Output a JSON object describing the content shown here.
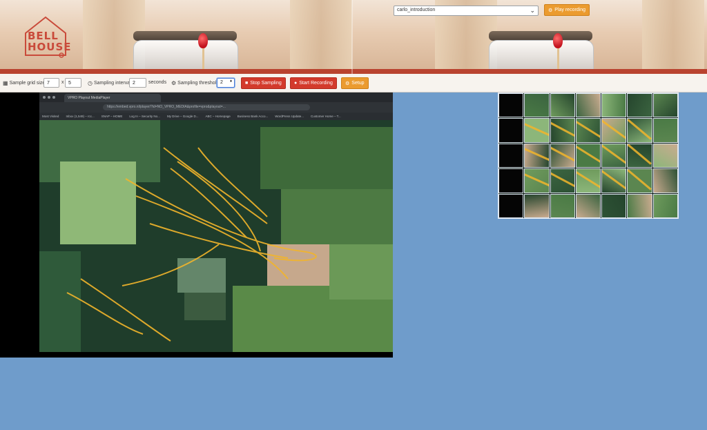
{
  "banner": {
    "logo_line1": "BELL",
    "logo_line2": "HOUSE"
  },
  "recording": {
    "selected": "carlo_introduction",
    "play_label": "Play recording"
  },
  "toolbar": {
    "grid_label": "Sample grid size",
    "grid_cols": "7",
    "grid_sep": "x",
    "grid_rows": "5",
    "interval_label": "Sampling interval",
    "interval_value": "2",
    "interval_unit": "seconds",
    "threshold_label": "Sampling threshold",
    "threshold_value": "2",
    "stop_label": "Stop Sampling",
    "record_label": "Start Recording",
    "setup_label": "Setup"
  },
  "browser": {
    "tab_title": "VPRO Playout MediaPlayer",
    "url": "https://embed.vpro.nl/player/?id=NO_VPRO_MEDIA&profile=vpro&playout=...",
    "bookmarks": [
      "Most Visited",
      "Inbox (1,549) – rcc...",
      "SNAP – HOME",
      "Log In – Security No...",
      "My Drive – Google D...",
      "ABC – Homepage",
      "Business Bank Acco...",
      "WordPress Update...",
      "Customer Home – T..."
    ]
  },
  "colors": {
    "page_bg": "#6f9ccb",
    "accent_orange": "#eb9b2f",
    "accent_red": "#d33a2c",
    "map_trail": "#f2b52b"
  }
}
